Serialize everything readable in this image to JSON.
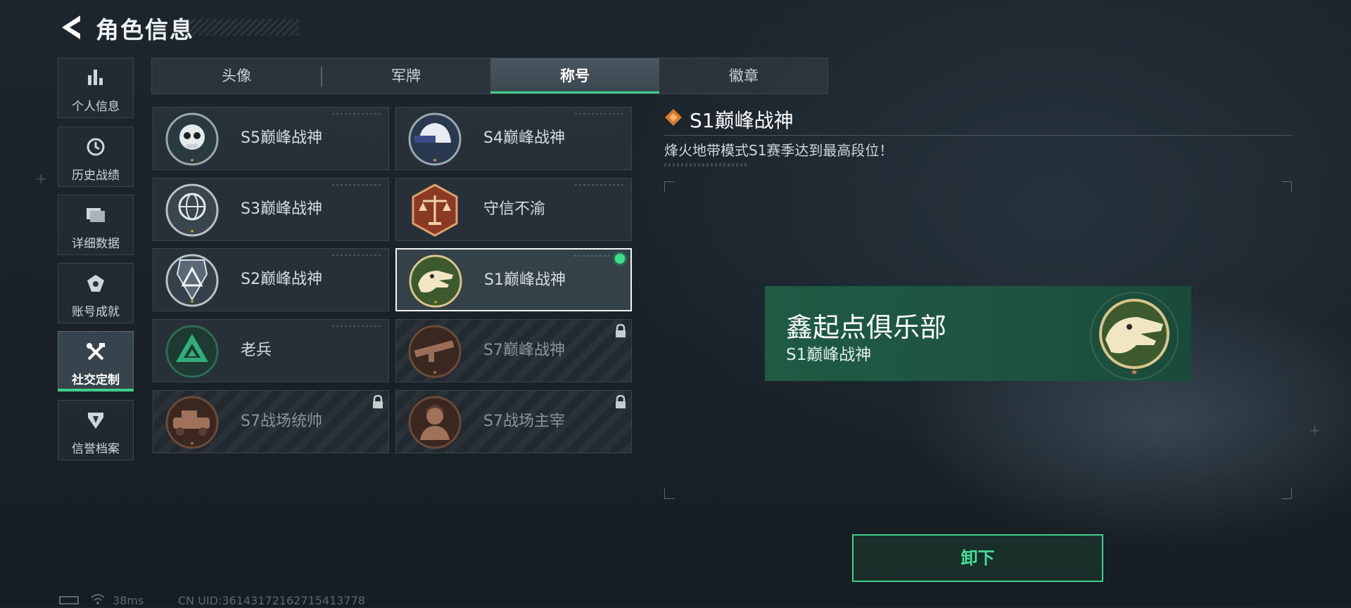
{
  "header": {
    "title": "角色信息"
  },
  "sidebar": {
    "items": [
      {
        "label": "个人信息",
        "icon": "bar-chart-icon"
      },
      {
        "label": "历史战绩",
        "icon": "history-clock-icon"
      },
      {
        "label": "详细数据",
        "icon": "folder-icon"
      },
      {
        "label": "账号成就",
        "icon": "achievement-icon"
      },
      {
        "label": "社交定制",
        "icon": "tools-icon",
        "active": true
      },
      {
        "label": "信誉档案",
        "icon": "shield-icon"
      }
    ]
  },
  "tabs": [
    {
      "label": "头像"
    },
    {
      "label": "军牌"
    },
    {
      "label": "称号",
      "active": true
    },
    {
      "label": "徽章"
    }
  ],
  "titles": [
    {
      "name": "S5巅峰战神",
      "locked": false
    },
    {
      "name": "S4巅峰战神",
      "locked": false
    },
    {
      "name": "S3巅峰战神",
      "locked": false
    },
    {
      "name": "守信不渝",
      "locked": false
    },
    {
      "name": "S2巅峰战神",
      "locked": false
    },
    {
      "name": "S1巅峰战神",
      "locked": false,
      "selected": true,
      "equipped": true
    },
    {
      "name": "老兵",
      "locked": false
    },
    {
      "name": "S7巅峰战神",
      "locked": true
    },
    {
      "name": "S7战场统帅",
      "locked": true
    },
    {
      "name": "S7战场主宰",
      "locked": true
    }
  ],
  "detail": {
    "title": "S1巅峰战神",
    "description": "烽火地带模式S1赛季达到最高段位！"
  },
  "preview": {
    "player_name": "鑫起点俱乐部",
    "title": "S1巅峰战神"
  },
  "actions": {
    "unequip_label": "卸下"
  },
  "status": {
    "ping": "38ms",
    "uid": "CN UID:36143172162715413778"
  },
  "colors": {
    "accent": "#3fd08a",
    "equipped_dot": "#39e28e",
    "preview_bg": "#1f5a43"
  }
}
